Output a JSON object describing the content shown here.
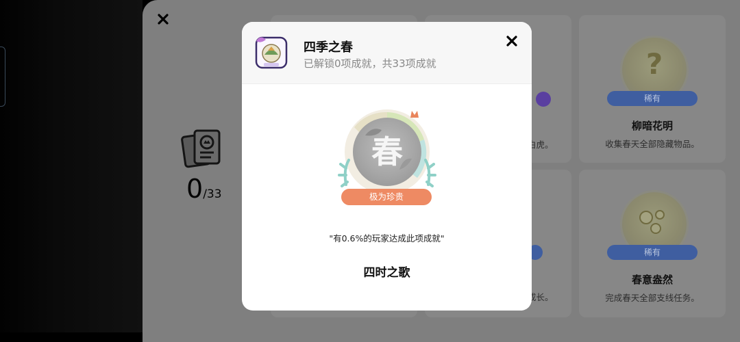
{
  "background": {
    "progress": {
      "unlocked": "0",
      "total": "/33"
    },
    "cards": [
      {
        "title": "",
        "desc_fragment": "白虎。",
        "badge": ""
      },
      {
        "title": "柳暗花明",
        "desc": "收集春天全部隐藏物品。",
        "badge": "稀有"
      },
      {
        "title": "",
        "desc_fragment": "成长。",
        "badge": ""
      },
      {
        "title": "春意盎然",
        "desc": "完成春天全部支线任务。",
        "badge": "稀有"
      }
    ]
  },
  "modal": {
    "title": "四季之春",
    "subtitle": "已解锁0项成就，共33项成就",
    "medal_char": "春",
    "rarity": "极为珍贵",
    "quote": "\"有0.6%的玩家达成此项成就\"",
    "achievement_name": "四时之歌"
  },
  "colors": {
    "rarity_badge": "#ee8a63",
    "rare_badge": "#3f5ea0",
    "modal_bg": "#ffffff"
  },
  "icons": [
    "close-icon",
    "achievement-cards-icon",
    "season-spring-icon",
    "lock-medal-icon",
    "crown-icon"
  ]
}
